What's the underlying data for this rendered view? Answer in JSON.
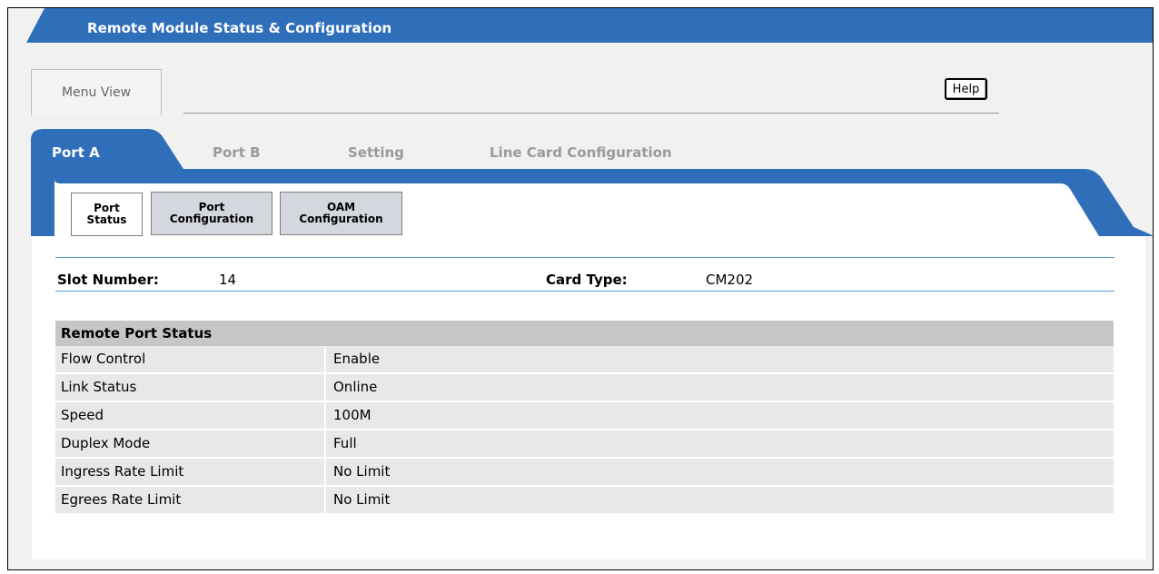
{
  "header": {
    "title": "Remote Module Status & Configuration"
  },
  "toolbar": {
    "menu_view_label": "Menu View",
    "help_label": "Help"
  },
  "tabs": [
    {
      "label": "Port A",
      "active": true
    },
    {
      "label": "Port B",
      "active": false
    },
    {
      "label": "Setting",
      "active": false
    },
    {
      "label": "Line Card Configuration",
      "active": false
    }
  ],
  "subtabs": [
    {
      "line1": "Port",
      "line2": "Status",
      "active": true
    },
    {
      "line1": "Port",
      "line2": "Configuration",
      "active": false
    },
    {
      "line1": "OAM",
      "line2": "Configuration",
      "active": false
    }
  ],
  "info": {
    "slot_label": "Slot Number:",
    "slot_value": "14",
    "card_label": "Card Type:",
    "card_value": "CM202"
  },
  "status": {
    "title": "Remote Port Status",
    "rows": [
      {
        "label": "Flow Control",
        "value": "Enable"
      },
      {
        "label": "Link Status",
        "value": "Online"
      },
      {
        "label": "Speed",
        "value": "100M"
      },
      {
        "label": "Duplex Mode",
        "value": "Full"
      },
      {
        "label": "Ingress Rate Limit",
        "value": "No Limit"
      },
      {
        "label": "Egrees Rate Limit",
        "value": "No Limit"
      }
    ]
  },
  "colors": {
    "brand_blue": "#2f6fba",
    "accent_line": "#4f9ad9"
  }
}
